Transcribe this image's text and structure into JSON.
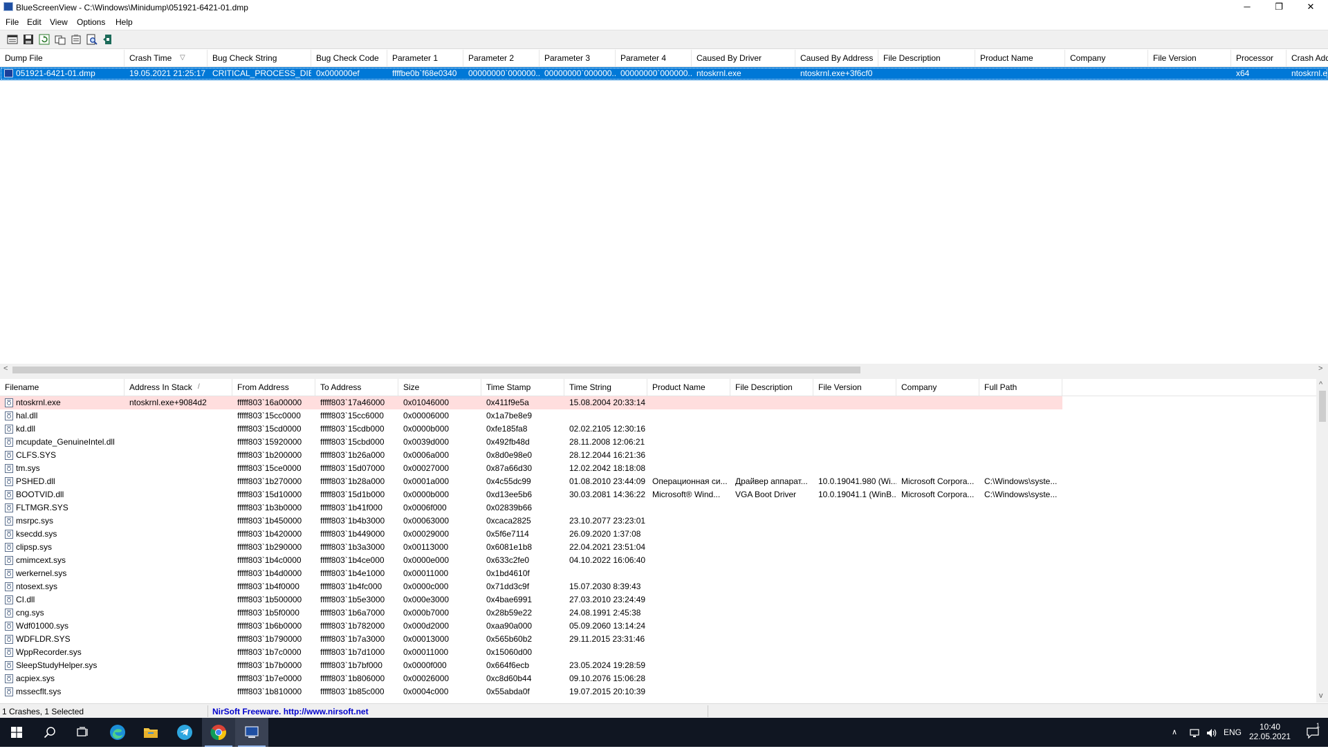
{
  "window": {
    "title": "BlueScreenView  -  C:\\Windows\\Minidump\\051921-6421-01.dmp",
    "min_glyph": "─",
    "restore_glyph": "❐",
    "close_glyph": "✕"
  },
  "menu": [
    "File",
    "Edit",
    "View",
    "Options",
    "Help"
  ],
  "toolbar": {
    "icons": [
      "html-report-icon",
      "save-icon",
      "refresh-icon",
      "copy-icon",
      "properties-icon",
      "find-icon",
      "exit-icon"
    ]
  },
  "crash_list": {
    "columns": [
      {
        "label": "Dump File"
      },
      {
        "label": "Crash Time",
        "sort": "▽"
      },
      {
        "label": "Bug Check String"
      },
      {
        "label": "Bug Check Code"
      },
      {
        "label": "Parameter 1"
      },
      {
        "label": "Parameter 2"
      },
      {
        "label": "Parameter 3"
      },
      {
        "label": "Parameter 4"
      },
      {
        "label": "Caused By Driver"
      },
      {
        "label": "Caused By Address"
      },
      {
        "label": "File Description"
      },
      {
        "label": "Product Name"
      },
      {
        "label": "Company"
      },
      {
        "label": "File Version"
      },
      {
        "label": "Processor"
      },
      {
        "label": "Crash Add"
      }
    ],
    "rows": [
      [
        "051921-6421-01.dmp",
        "19.05.2021 21:25:17",
        "CRITICAL_PROCESS_DIED",
        "0x000000ef",
        "ffffbe0b`f68e0340",
        "00000000`000000...",
        "00000000`000000...",
        "00000000`000000...",
        "ntoskrnl.exe",
        "ntoskrnl.exe+3f6cf0",
        "",
        "",
        "",
        "",
        "x64",
        "ntoskrnl.e"
      ]
    ]
  },
  "driver_list": {
    "columns": [
      {
        "label": "Filename"
      },
      {
        "label": "Address In Stack",
        "sort": "/"
      },
      {
        "label": "From Address"
      },
      {
        "label": "To Address"
      },
      {
        "label": "Size"
      },
      {
        "label": "Time Stamp"
      },
      {
        "label": "Time String"
      },
      {
        "label": "Product Name"
      },
      {
        "label": "File Description"
      },
      {
        "label": "File Version"
      },
      {
        "label": "Company"
      },
      {
        "label": "Full Path"
      }
    ],
    "rows": [
      [
        "ntoskrnl.exe",
        "ntoskrnl.exe+9084d2",
        "fffff803`16a00000",
        "fffff803`17a46000",
        "0x01046000",
        "0x411f9e5a",
        "15.08.2004 20:33:14",
        "",
        "",
        "",
        "",
        ""
      ],
      [
        "hal.dll",
        "",
        "fffff803`15cc0000",
        "fffff803`15cc6000",
        "0x00006000",
        "0x1a7be8e9",
        "",
        "",
        "",
        "",
        "",
        ""
      ],
      [
        "kd.dll",
        "",
        "fffff803`15cd0000",
        "fffff803`15cdb000",
        "0x0000b000",
        "0xfe185fa8",
        "02.02.2105 12:30:16",
        "",
        "",
        "",
        "",
        ""
      ],
      [
        "mcupdate_GenuineIntel.dll",
        "",
        "fffff803`15920000",
        "fffff803`15cbd000",
        "0x0039d000",
        "0x492fb48d",
        "28.11.2008 12:06:21",
        "",
        "",
        "",
        "",
        ""
      ],
      [
        "CLFS.SYS",
        "",
        "fffff803`1b200000",
        "fffff803`1b26a000",
        "0x0006a000",
        "0x8d0e98e0",
        "28.12.2044 16:21:36",
        "",
        "",
        "",
        "",
        ""
      ],
      [
        "tm.sys",
        "",
        "fffff803`15ce0000",
        "fffff803`15d07000",
        "0x00027000",
        "0x87a66d30",
        "12.02.2042 18:18:08",
        "",
        "",
        "",
        "",
        ""
      ],
      [
        "PSHED.dll",
        "",
        "fffff803`1b270000",
        "fffff803`1b28a000",
        "0x0001a000",
        "0x4c55dc99",
        "01.08.2010 23:44:09",
        "Операционная си...",
        "Драйвер аппарат...",
        "10.0.19041.980 (Wi...",
        "Microsoft Corpora...",
        "C:\\Windows\\syste..."
      ],
      [
        "BOOTVID.dll",
        "",
        "fffff803`15d10000",
        "fffff803`15d1b000",
        "0x0000b000",
        "0xd13ee5b6",
        "30.03.2081 14:36:22",
        "Microsoft® Wind...",
        "VGA Boot Driver",
        "10.0.19041.1 (WinB...",
        "Microsoft Corpora...",
        "C:\\Windows\\syste..."
      ],
      [
        "FLTMGR.SYS",
        "",
        "fffff803`1b3b0000",
        "fffff803`1b41f000",
        "0x0006f000",
        "0x02839b66",
        "",
        "",
        "",
        "",
        "",
        ""
      ],
      [
        "msrpc.sys",
        "",
        "fffff803`1b450000",
        "fffff803`1b4b3000",
        "0x00063000",
        "0xcaca2825",
        "23.10.2077 23:23:01",
        "",
        "",
        "",
        "",
        ""
      ],
      [
        "ksecdd.sys",
        "",
        "fffff803`1b420000",
        "fffff803`1b449000",
        "0x00029000",
        "0x5f6e7114",
        "26.09.2020 1:37:08",
        "",
        "",
        "",
        "",
        ""
      ],
      [
        "clipsp.sys",
        "",
        "fffff803`1b290000",
        "fffff803`1b3a3000",
        "0x00113000",
        "0x6081e1b8",
        "22.04.2021 23:51:04",
        "",
        "",
        "",
        "",
        ""
      ],
      [
        "cmimcext.sys",
        "",
        "fffff803`1b4c0000",
        "fffff803`1b4ce000",
        "0x0000e000",
        "0x633c2fe0",
        "04.10.2022 16:06:40",
        "",
        "",
        "",
        "",
        ""
      ],
      [
        "werkernel.sys",
        "",
        "fffff803`1b4d0000",
        "fffff803`1b4e1000",
        "0x00011000",
        "0x1bd4610f",
        "",
        "",
        "",
        "",
        "",
        ""
      ],
      [
        "ntosext.sys",
        "",
        "fffff803`1b4f0000",
        "fffff803`1b4fc000",
        "0x0000c000",
        "0x71dd3c9f",
        "15.07.2030 8:39:43",
        "",
        "",
        "",
        "",
        ""
      ],
      [
        "CI.dll",
        "",
        "fffff803`1b500000",
        "fffff803`1b5e3000",
        "0x000e3000",
        "0x4bae6991",
        "27.03.2010 23:24:49",
        "",
        "",
        "",
        "",
        ""
      ],
      [
        "cng.sys",
        "",
        "fffff803`1b5f0000",
        "fffff803`1b6a7000",
        "0x000b7000",
        "0x28b59e22",
        "24.08.1991 2:45:38",
        "",
        "",
        "",
        "",
        ""
      ],
      [
        "Wdf01000.sys",
        "",
        "fffff803`1b6b0000",
        "fffff803`1b782000",
        "0x000d2000",
        "0xaa90a000",
        "05.09.2060 13:14:24",
        "",
        "",
        "",
        "",
        ""
      ],
      [
        "WDFLDR.SYS",
        "",
        "fffff803`1b790000",
        "fffff803`1b7a3000",
        "0x00013000",
        "0x565b60b2",
        "29.11.2015 23:31:46",
        "",
        "",
        "",
        "",
        ""
      ],
      [
        "WppRecorder.sys",
        "",
        "fffff803`1b7c0000",
        "fffff803`1b7d1000",
        "0x00011000",
        "0x15060d00",
        "",
        "",
        "",
        "",
        "",
        ""
      ],
      [
        "SleepStudyHelper.sys",
        "",
        "fffff803`1b7b0000",
        "fffff803`1b7bf000",
        "0x0000f000",
        "0x664f6ecb",
        "23.05.2024 19:28:59",
        "",
        "",
        "",
        "",
        ""
      ],
      [
        "acpiex.sys",
        "",
        "fffff803`1b7e0000",
        "fffff803`1b806000",
        "0x00026000",
        "0xc8d60b44",
        "09.10.2076 15:06:28",
        "",
        "",
        "",
        "",
        ""
      ],
      [
        "mssecflt.sys",
        "",
        "fffff803`1b810000",
        "fffff803`1b85c000",
        "0x0004c000",
        "0x55abda0f",
        "19.07.2015 20:10:39",
        "",
        "",
        "",
        "",
        ""
      ]
    ]
  },
  "status": {
    "left": "1 Crashes, 1 Selected",
    "right": "NirSoft Freeware.  http://www.nirsoft.net"
  },
  "taskbar": {
    "apps": [
      "start-icon",
      "search-icon",
      "task-view-icon",
      "edge-icon",
      "file-explorer-icon",
      "telegram-icon",
      "chrome-icon",
      "bluescreenview-icon"
    ],
    "lang": "ENG",
    "time": "10:40",
    "date": "22.05.2021",
    "notification_count": "1"
  },
  "colors": {
    "selection": "#0078d7",
    "highlight_row": "#ffdede",
    "taskbar": "#101622",
    "status_link": "#0000cc"
  }
}
